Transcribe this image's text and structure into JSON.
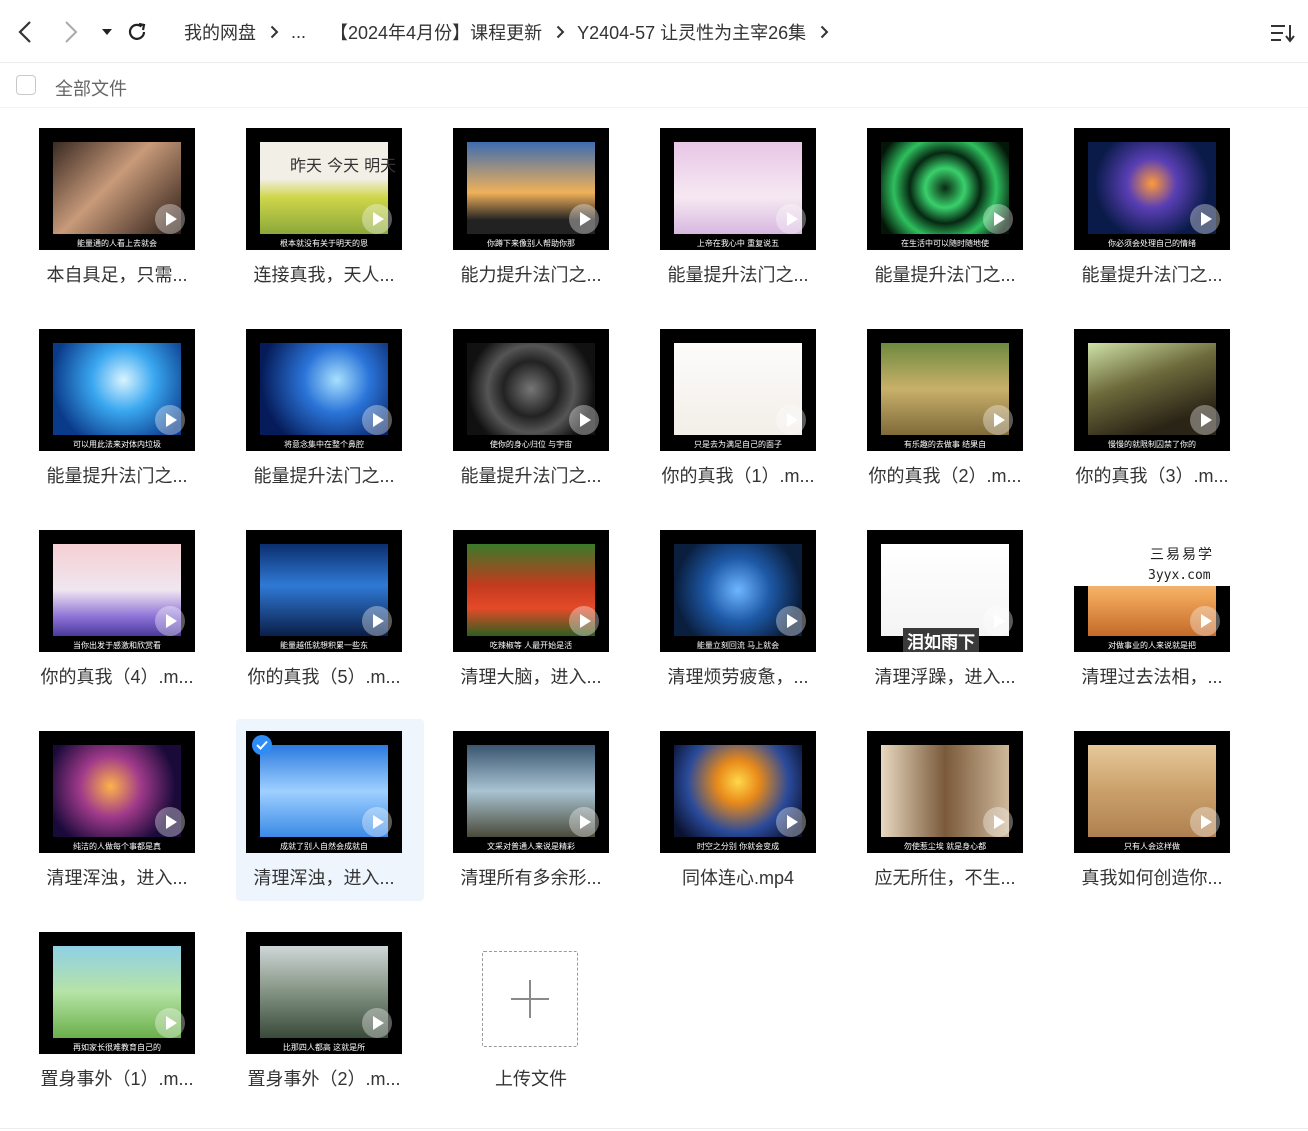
{
  "nav": {
    "breadcrumbs": [
      "我的网盘",
      "...",
      "【2024年4月份】课程更新",
      "Y2404-57 让灵性为主宰26集"
    ]
  },
  "subbar": {
    "all_files_label": "全部文件"
  },
  "files": [
    {
      "name": "本自具足，只需...",
      "subtitle": "能量通的人看上去就会",
      "bg": "linear-gradient(135deg,#3a2a22,#c89a7a 45%,#2a1c16)"
    },
    {
      "name": "连接真我，天人...",
      "subtitle": "根本就没有关于明天的恩",
      "bg": "linear-gradient(180deg,#f2efe6 0%,#f2efe6 40%,#cfd64a 60%,#8ca83a 100%)",
      "overlay": "昨天 今天 明天"
    },
    {
      "name": "能力提升法门之...",
      "subtitle": "你蹲下来像别人帮助你那",
      "bg": "linear-gradient(180deg,#3d6cb0 0%,#f0b15a 55%,#222 85%)"
    },
    {
      "name": "能量提升法门之...",
      "subtitle": "上帝在我心中 重复说五",
      "bg": "linear-gradient(180deg,#e7c6e6,#f6e9f2 60%,#d7b8e0)"
    },
    {
      "name": "能量提升法门之...",
      "subtitle": "在生活中可以随时随地使",
      "bg": "radial-gradient(circle,#0a2a12 0%,#3ad06c 25%,#062812 45%,#2fbf5e 65%,#031608 90%)"
    },
    {
      "name": "能量提升法门之...",
      "subtitle": "你必须会处理自己的情绪",
      "bg": "radial-gradient(circle at 50% 45%,#ff9a3a 0%,#5a3fb5 30%,#0a1b4a 70%)"
    },
    {
      "name": "能量提升法门之...",
      "subtitle": "可以用此法来对体内垃圾",
      "bg": "radial-gradient(circle at 55% 40%,#d8f4ff 0%,#3aa7f0 35%,#0a3a8a 80%)"
    },
    {
      "name": "能量提升法门之...",
      "subtitle": "将意念集中在整个鼻腔",
      "bg": "radial-gradient(circle at 60% 40%,#a8e0ff 0%,#2a74d8 35%,#061c5a 80%)"
    },
    {
      "name": "能量提升法门之...",
      "subtitle": "使你的身心归位 与宇宙",
      "bg": "radial-gradient(circle,#777 0%,#222 35%,#555 55%,#111 80%)"
    },
    {
      "name": "你的真我（1）.m...",
      "subtitle": "只是去为满足自己的面子",
      "bg": "linear-gradient(180deg,#fdfcfb,#f2eee8)"
    },
    {
      "name": "你的真我（2）.m...",
      "subtitle": "有乐趣的去做事 结果自",
      "bg": "linear-gradient(180deg,#6e8a3e,#c9b06a 50%,#7f6a3a)"
    },
    {
      "name": "你的真我（3）.m...",
      "subtitle": "慢慢的就限制囚禁了你的",
      "bg": "linear-gradient(160deg,#cfe2a6 0%,#6d6a3c 40%,#2a2416 80%)"
    },
    {
      "name": "你的真我（4）.m...",
      "subtitle": "当你出发于感激和欣赏看",
      "bg": "linear-gradient(180deg,#f5cfd3,#f0e6f0 50%,#8a6fd6 80%,#4a3a9a)"
    },
    {
      "name": "你的真我（5）.m...",
      "subtitle": "能量越低就想积累一些东",
      "bg": "linear-gradient(180deg,#0b2e6e,#2f7ad6 45%,#0a1e48)"
    },
    {
      "name": "清理大脑，进入...",
      "subtitle": "吃辣椒等 人最开始是活",
      "bg": "linear-gradient(180deg,#3a7a2a,#c43a1e 45%,#e44a28 70%,#2e5e20)"
    },
    {
      "name": "清理烦劳疲惫，...",
      "subtitle": "能量立刻回流 马上就会",
      "bg": "radial-gradient(circle at 50% 50%,#6fb6ff 0%,#1e5aa8 40%,#0a1e3e 80%)"
    },
    {
      "name": "清理浮躁，进入...",
      "subtitle": "",
      "bg": "linear-gradient(180deg,#ffffff,#f4f4f4)",
      "overlay": "泪如雨下"
    },
    {
      "name": "清理过去法相，...",
      "subtitle": "对做事业的人来说就是把",
      "bg": "linear-gradient(180deg,#f6e6c8,#f0a85a 55%,#c46a2a)",
      "watermark": [
        "三易易学",
        "3yyx.com"
      ]
    },
    {
      "name": "清理浑浊，进入...",
      "subtitle": "纯洁的人做每个事都是真",
      "bg": "radial-gradient(circle at 45% 45%,#ffb24a 0%,#a03a8a 35%,#1a0a3a 75%)"
    },
    {
      "name": "清理浑浊，进入...",
      "subtitle": "成就了别人自然会成就自",
      "bg": "linear-gradient(180deg,#2a7ae0,#9fd0ff 50%,#3a8ae6)"
    },
    {
      "name": "清理所有多余形...",
      "subtitle": "文采对普通人来说是精彩",
      "bg": "linear-gradient(180deg,#3a5670,#a9c3d2 50%,#4a4a3a)"
    },
    {
      "name": "同体连心.mp4",
      "subtitle": "时空之分别 你就会变成",
      "bg": "radial-gradient(circle at 50% 40%,#ffd84a 0%,#e88a1a 25%,#2a4a9a 60%,#0a1230 90%)"
    },
    {
      "name": "应无所住，不生...",
      "subtitle": "勿使惹尘埃 就是身心都",
      "bg": "linear-gradient(90deg,#e8d8c0,#7a5a3a 50%,#cfb89a)"
    },
    {
      "name": "真我如何创造你...",
      "subtitle": "只有人会这样做",
      "bg": "linear-gradient(180deg,#e6c89a,#caa06a 50%,#b08050)"
    },
    {
      "name": "置身事外（1）.m...",
      "subtitle": "再如家长很难教育自己的",
      "bg": "linear-gradient(180deg,#8fd0e6,#b6e3a6 50%,#6ab04a)"
    },
    {
      "name": "置身事外（2）.m...",
      "subtitle": "比那四人都高 这就是所",
      "bg": "linear-gradient(180deg,#cfd6d8,#8a9a8a 45%,#3a4a3a)"
    }
  ],
  "upload": {
    "label": "上传文件"
  }
}
